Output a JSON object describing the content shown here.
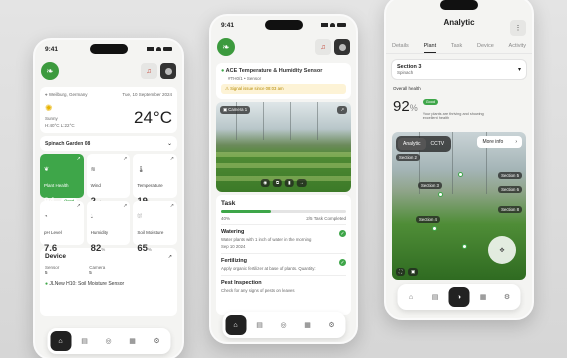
{
  "colors": {
    "accent": "#3ea649",
    "dark": "#222222",
    "background": "#dcdcdc"
  },
  "phone1": {
    "time": "9:41",
    "location": "Weilburg, Germany",
    "date": "Tue, 10 September 2024",
    "weather": {
      "condition": "Sunny",
      "hl": "H:40°C  L:22°C",
      "temp": "24°C"
    },
    "garden": "Spinach Garden 08",
    "tiles": [
      {
        "label": "Plant Health",
        "value": "94",
        "unit": "%",
        "badge": "Good",
        "icon": "leaf-icon"
      },
      {
        "label": "Wind",
        "value": "2",
        "unit": "m/s",
        "icon": "wind-icon"
      },
      {
        "label": "Temperature",
        "value": "19",
        "unit": "°C",
        "icon": "thermometer-icon"
      },
      {
        "label": "pH Level",
        "value": "7.6",
        "unit": "",
        "icon": "ph-icon"
      },
      {
        "label": "Humidity",
        "value": "82",
        "unit": "%",
        "icon": "humidity-icon"
      },
      {
        "label": "Soil Moisture",
        "value": "65",
        "unit": "%",
        "icon": "soil-icon"
      }
    ],
    "device": {
      "title": "Device",
      "sensor_label": "Sensor",
      "sensor_value": "5",
      "camera_label": "Camera",
      "camera_value": "5",
      "item": "JLNew H10: Soil Moisture Sensor"
    }
  },
  "phone2": {
    "time": "9:41",
    "sensor_title": "ACE Temperature & Humidity Sensor",
    "sensor_meta": "#TH0/1  •  Sensor",
    "sensor_alert": "Signal issue since 08:03 am",
    "camera_label": "Camera 1",
    "task": {
      "title": "Task",
      "progress_label": "40%",
      "progress_value": 0.4,
      "completed": "2/5 Task Completed",
      "items": [
        {
          "title": "Watering",
          "desc": "Water plants with 1 inch of water in the morning",
          "date": "Sep 10 2024"
        },
        {
          "title": "Fertilizing",
          "desc": "Apply organic fertilizer at base of plants. Quantity:",
          "date": ""
        },
        {
          "title": "Pest Inspection",
          "desc": "Check for any signs of pests on leaves",
          "date": ""
        }
      ]
    }
  },
  "phone3": {
    "title": "Analytic",
    "tabs": [
      "Details",
      "Plant",
      "Task",
      "Device",
      "Activity"
    ],
    "active_tab": "Plant",
    "section_select": "Section 3",
    "section_sub": "Spinach",
    "overall_label": "Overall health",
    "overall_value": "92",
    "overall_unit": "%",
    "overall_badge": "Good",
    "overall_desc": "Your plants are thriving and showing excellent health",
    "view_tabs": [
      "Analytic",
      "CCTV"
    ],
    "more_info": "More info",
    "sections": [
      "Section 2",
      "Section 3",
      "Section 4",
      "Section 5",
      "Section 6",
      "Section 8"
    ]
  }
}
